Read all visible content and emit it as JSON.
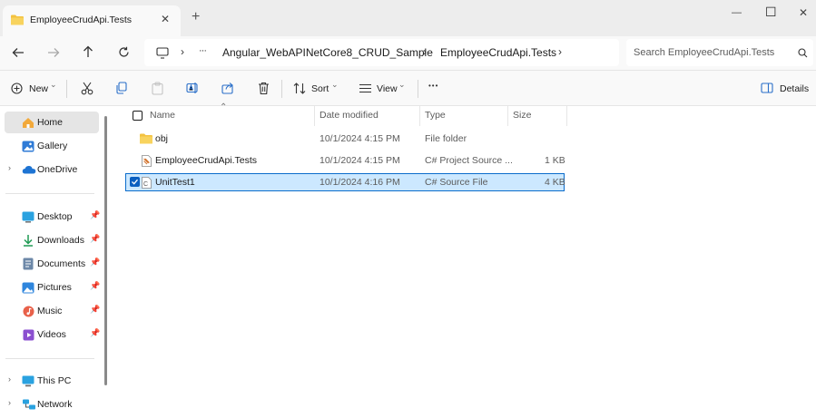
{
  "window": {
    "tab_title": "EmployeeCrudApi.Tests",
    "new_tab_glyph": "+",
    "close_glyph": "✕",
    "minimize_glyph": "—",
    "maximize_glyph": "☐",
    "window_close_glyph": "✕"
  },
  "address": {
    "ellipsis": "···",
    "sep": "›",
    "crumbs": [
      "Angular_WebAPINetCore8_CRUD_Sample",
      "EmployeeCrudApi.Tests"
    ],
    "search_placeholder": "Search EmployeeCrudApi.Tests"
  },
  "toolbar": {
    "new_label": "New",
    "sort_label": "Sort",
    "view_label": "View",
    "more_glyph": "•••",
    "details_label": "Details",
    "caret": "⌄"
  },
  "sidebar": {
    "top_items": [
      {
        "label": "Home",
        "icon": "home-icon"
      },
      {
        "label": "Gallery",
        "icon": "gallery-icon"
      },
      {
        "label": "OneDrive",
        "icon": "cloud-icon"
      }
    ],
    "quick_access": [
      {
        "label": "Desktop",
        "icon": "desktop-icon"
      },
      {
        "label": "Downloads",
        "icon": "download-icon"
      },
      {
        "label": "Documents",
        "icon": "documents-icon"
      },
      {
        "label": "Pictures",
        "icon": "pictures-icon"
      },
      {
        "label": "Music",
        "icon": "music-icon"
      },
      {
        "label": "Videos",
        "icon": "videos-icon"
      }
    ],
    "bottom_items": [
      {
        "label": "This PC",
        "icon": "pc-icon"
      },
      {
        "label": "Network",
        "icon": "network-icon"
      }
    ],
    "pin_glyph": "📌",
    "chevron": "›"
  },
  "columns": {
    "name": "Name",
    "date_modified": "Date modified",
    "type": "Type",
    "size": "Size",
    "sort_arrow": "⌃"
  },
  "files": [
    {
      "name": "obj",
      "date": "10/1/2024 4:15 PM",
      "type": "File folder",
      "size": "",
      "icon": "folder-icon"
    },
    {
      "name": "EmployeeCrudApi.Tests",
      "date": "10/1/2024 4:15 PM",
      "type": "C# Project Source ...",
      "size": "1 KB",
      "icon": "csproj-icon"
    },
    {
      "name": "UnitTest1",
      "date": "10/1/2024 4:16 PM",
      "type": "C# Source File",
      "size": "4 KB",
      "icon": "cs-file-icon",
      "selected": true
    }
  ],
  "colors": {
    "accent": "#0b5fc0",
    "selection_bg": "#cce8ff",
    "folder": "#f3c240"
  }
}
